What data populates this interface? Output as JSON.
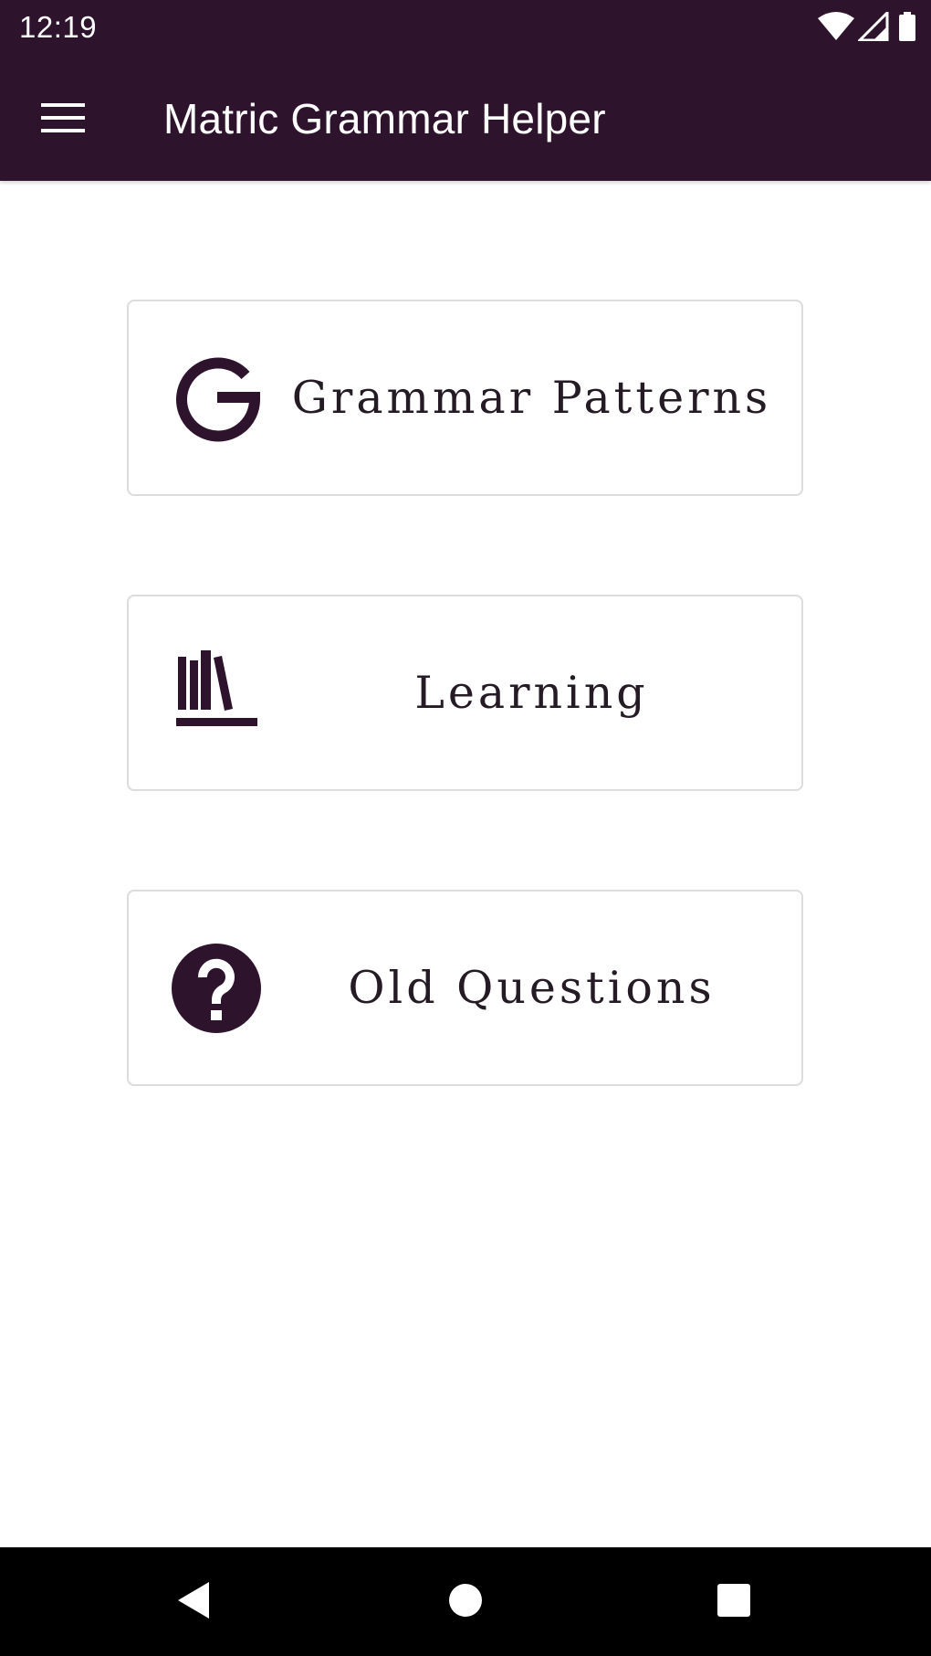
{
  "status_bar": {
    "time": "12:19",
    "icons": [
      "wifi-icon",
      "signal-icon",
      "battery-icon"
    ]
  },
  "app_bar": {
    "menu_icon": "menu-icon",
    "title": "Matric Grammar Helper"
  },
  "menu": {
    "items": [
      {
        "label": "Grammar Patterns",
        "icon": "grammar-g-icon"
      },
      {
        "label": "Learning",
        "icon": "books-icon"
      },
      {
        "label": "Old Questions",
        "icon": "question-circle-icon"
      }
    ]
  },
  "nav_bar": {
    "buttons": [
      "back-icon",
      "home-icon",
      "recents-icon"
    ]
  },
  "colors": {
    "primary": "#2e132d",
    "background": "#ffffff",
    "card_border": "#dcdcdc",
    "label_text": "#241b24",
    "nav_bar": "#000000"
  }
}
